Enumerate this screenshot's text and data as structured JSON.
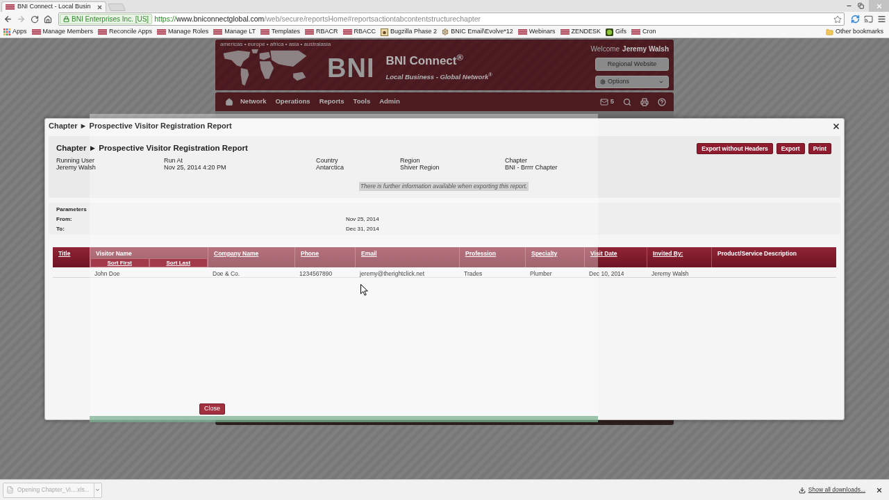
{
  "browser": {
    "tab": {
      "title": "BNI Connect - Local Busin"
    },
    "address": {
      "ev_badge": "BNI Enterprises Inc. [US]",
      "scheme": "https://",
      "host": "www.bniconnectglobal.com",
      "path": "/web/secure/reportsHome#reportsactiontabcontentstructurechapter"
    },
    "bookmarks": [
      {
        "kind": "apps",
        "label": "Apps"
      },
      {
        "kind": "bni",
        "label": "Manage Members"
      },
      {
        "kind": "bni",
        "label": "Reconcile Apps"
      },
      {
        "kind": "bni",
        "label": "Manage Roles"
      },
      {
        "kind": "bni",
        "label": "Manage LT"
      },
      {
        "kind": "bni",
        "label": "Templates"
      },
      {
        "kind": "bni",
        "label": "RBACR"
      },
      {
        "kind": "bni",
        "label": "RBACC"
      },
      {
        "kind": "page",
        "label": "Bugzilla Phase 2"
      },
      {
        "kind": "cog",
        "label": "BNIC Email\\Evolve*12"
      },
      {
        "kind": "bni",
        "label": "Webinars"
      },
      {
        "kind": "bni",
        "label": "ZENDESK"
      },
      {
        "kind": "tile",
        "label": "Gifs"
      },
      {
        "kind": "bni",
        "label": "Cron"
      }
    ],
    "other_bookmarks": "Other bookmarks"
  },
  "page": {
    "regions": "americas • europe • africa • asia • australasia",
    "logo": "BNI",
    "brand": "BNI Connect$^{®}$",
    "tagline": "Local Business - Global Network$^{®}$",
    "welcome": "Welcome",
    "user": "Jeremy Walsh",
    "regional_button": "Regional Website",
    "options_button": "Options",
    "nav": [
      "Network",
      "Operations",
      "Reports",
      "Tools",
      "Admin"
    ],
    "mail_count": "5"
  },
  "dialog": {
    "title": "Chapter ► Prospective Visitor Registration Report",
    "report_title": "Chapter ► Prospective Visitor Registration Report",
    "actions": [
      "Export without Headers",
      "Export",
      "Print"
    ],
    "info": [
      {
        "label": "Running User",
        "value": "Jeremy Walsh"
      },
      {
        "label": "Run At",
        "value": "Nov 25, 2014 4:20 PM"
      },
      {
        "label": "Country",
        "value": "Antarctica"
      },
      {
        "label": "Region",
        "value": "Shiver Region"
      },
      {
        "label": "Chapter",
        "value": "BNI - Brrrr Chapter"
      }
    ],
    "notice": "There is further information available when exporting this report.",
    "parameters": {
      "heading": "Parameters",
      "rows": [
        {
          "label": "From:",
          "value": "Nov 25, 2014"
        },
        {
          "label": "To:",
          "value": "Dec 31, 2014"
        }
      ]
    },
    "table": {
      "columns": [
        {
          "label": "Title",
          "link": true
        },
        {
          "label": "Visitor Name",
          "link": false,
          "sort_links": [
            "Sort First",
            "Sort Last"
          ]
        },
        {
          "label": "Company Name",
          "link": true
        },
        {
          "label": "Phone",
          "link": true
        },
        {
          "label": "Email",
          "link": true
        },
        {
          "label": "Profession",
          "link": true
        },
        {
          "label": "Specialty",
          "link": true
        },
        {
          "label": "Visit Date",
          "link": true
        },
        {
          "label": "Invited By:",
          "link": true
        },
        {
          "label": "Product/Service Description",
          "link": false
        }
      ],
      "rows": [
        [
          null,
          "John Doe",
          "Doe & Co.",
          "1234567890",
          "jeremy@therightclick.net",
          "Trades",
          "Plumber",
          "Dec 10, 2014",
          "Jeremy Walsh",
          null
        ]
      ]
    },
    "close_button": "Close"
  },
  "downloads": {
    "item": "Opening Chapter_Vi....xls...",
    "show_all": "Show all downloads..."
  }
}
